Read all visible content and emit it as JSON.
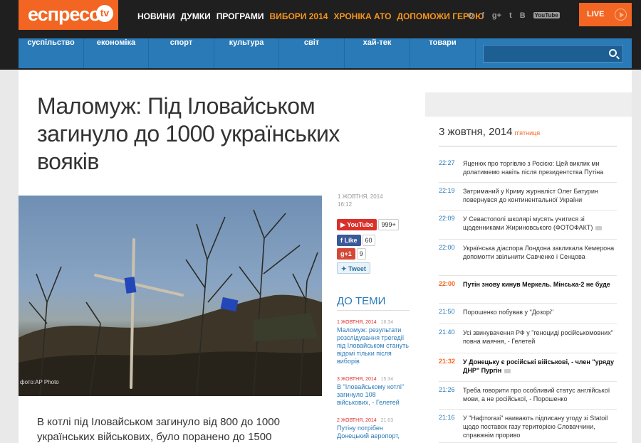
{
  "header": {
    "logo_text": "еспресо",
    "logo_tv": "tv",
    "nav": [
      {
        "label": "НОВИНИ",
        "highlight": false
      },
      {
        "label": "ДУМКИ",
        "highlight": false
      },
      {
        "label": "ПРОГРАМИ",
        "highlight": false
      },
      {
        "label": "ВИБОРИ 2014",
        "highlight": true
      },
      {
        "label": "ХРОНІКА АТО",
        "highlight": true
      },
      {
        "label": "ДОПОМОЖИ ГЕРОЮ",
        "highlight": true
      }
    ],
    "social": [
      {
        "icon": "rss-icon",
        "glyph": "⊙"
      },
      {
        "icon": "facebook-icon",
        "glyph": "f"
      },
      {
        "icon": "googleplus-icon",
        "glyph": "g+"
      },
      {
        "icon": "twitter-icon",
        "glyph": "t"
      },
      {
        "icon": "vk-icon",
        "glyph": "B"
      },
      {
        "icon": "youtube-icon",
        "glyph": "YouTube"
      }
    ],
    "live_label": "LIVE"
  },
  "categories": [
    "суспільство",
    "економіка",
    "спорт",
    "культура",
    "світ",
    "хай-тек",
    "товари"
  ],
  "search": {
    "placeholder": ""
  },
  "article": {
    "title": "Маломуж: Під Іловайськом загинуло до 1000 українських вояків",
    "photo_credit": "фото:AP Photo",
    "lead": "В котлі під Іловайськом загинуло від 800 до 1000 українських військових, було поранено до 1500",
    "date": "1 ЖОВТНЯ, 2014",
    "time": "16:12"
  },
  "share": {
    "youtube_label": "YouTube",
    "youtube_count": "999+",
    "fb_label": "Like",
    "fb_count": "60",
    "gplus_label": "+1",
    "gplus_count": "9",
    "tweet_label": "Tweet"
  },
  "related": {
    "heading": "ДО ТЕМИ",
    "items": [
      {
        "date": "1 ЖОВТНЯ, 2014",
        "time": "16:34",
        "headline": "Маломуж: результати розслідування трегедії під Іловайськом стануть відомі тільки після виборів"
      },
      {
        "date": "3 ЖОВТНЯ, 2014",
        "time": "15:34",
        "headline": "В \"Іловайському котлі\" загинуло 108 військових, - Гелетей"
      },
      {
        "date": "2 ЖОВТНЯ, 2014",
        "time": "21:03",
        "headline": "Путіну потрібен Донецький аеропорт,"
      }
    ]
  },
  "sidebar": {
    "date": "3 жовтня, 2014",
    "weekday": "п'ятниця",
    "news": [
      {
        "time": "22:27",
        "headline": "Яценюк про торгівлю з Росією: Цей виклик ми долатимемо навіть після президентства Путіна",
        "bold": false,
        "photo": false
      },
      {
        "time": "22:19",
        "headline": "Затриманий у Криму журналіст Олег Батурин повернувся до континентальної України",
        "bold": false,
        "photo": false
      },
      {
        "time": "22:09",
        "headline": "У Севастополі школярі мусять учитися зі щоденниками Жириновського (ФОТОФАКТ)",
        "bold": false,
        "photo": true
      },
      {
        "time": "22:00",
        "headline": "Українська діаспора Лондона закликала Кемерона допомогти звільнити Савченко і Сенцова",
        "bold": false,
        "photo": false
      },
      {
        "time": "22:00",
        "headline": "Путін знову кинув Меркель. Мінська-2 не буде",
        "bold": true,
        "photo": false
      },
      {
        "time": "21:50",
        "headline": "Порошенко побував у \"Дозорі\"",
        "bold": false,
        "photo": false
      },
      {
        "time": "21:40",
        "headline": "Усі звинувачення РФ у \"геноциді російськомовних\" повна маячня, - Гелетей",
        "bold": false,
        "photo": false
      },
      {
        "time": "21:32",
        "headline": "У Донецьку є російські військові, - член \"уряду ДНР\" Пургін",
        "bold": true,
        "photo": true
      },
      {
        "time": "21:26",
        "headline": "Треба говорити про особливий статус англійської мови, а не російської, - Порошенко",
        "bold": false,
        "photo": false
      },
      {
        "time": "21:16",
        "headline": "У \"Нафтогазі\" наивають підписану угоду зі Statoil щодо поставок газу територією Словаччини, справжнім прориво",
        "bold": false,
        "photo": false
      }
    ]
  }
}
